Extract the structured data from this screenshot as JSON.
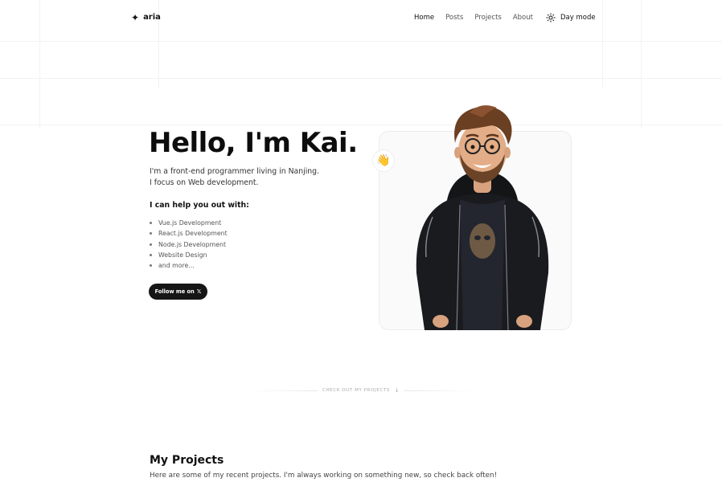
{
  "header": {
    "logo_icon": "✦",
    "logo_text": "aria",
    "nav": [
      "Home",
      "Posts",
      "Projects",
      "About"
    ],
    "active_nav": "Home",
    "theme_toggle_label": "Day mode",
    "theme_toggle_icon": "sun-icon"
  },
  "hero": {
    "title": "Hello, I'm Kai.",
    "intro_line1": "I'm a front-end programmer living in Nanjing.",
    "intro_line2": "I focus on Web development.",
    "help_title": "I can help you out with:",
    "skills": [
      "Vue.js Development",
      "React.js Development",
      "Node.js Development",
      "Website Design",
      "and more..."
    ],
    "follow_label": "Follow me on",
    "follow_icon": "𝕏",
    "wave_emoji": "👋"
  },
  "divider": {
    "label": "CHECK OUT MY PROJECTS",
    "arrow": "↓"
  },
  "projects": {
    "title": "My Projects",
    "description": "Here are some of my recent projects. I'm always working on something new, so check back often!"
  },
  "colors": {
    "button_bg": "#161616",
    "text_primary": "#111111",
    "text_muted": "#555555",
    "card_border": "#ececec"
  }
}
